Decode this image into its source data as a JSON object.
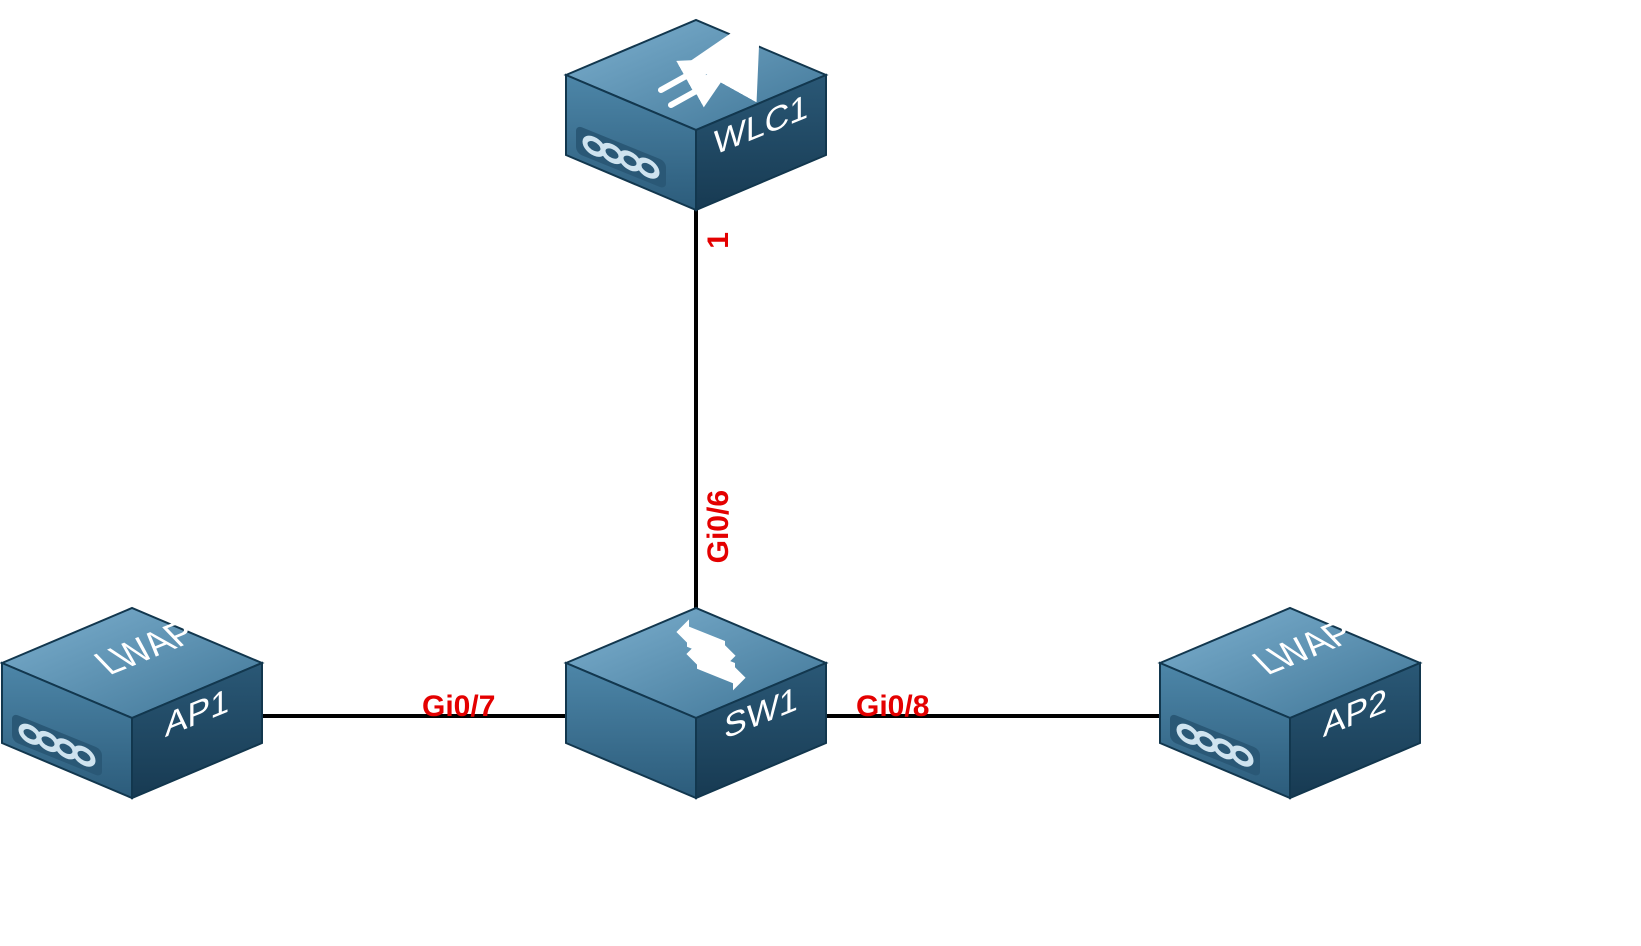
{
  "devices": {
    "wlc1": {
      "label": "WLC1",
      "topCap": ""
    },
    "sw1": {
      "label": "SW1",
      "topCap": ""
    },
    "ap1": {
      "label": "AP1",
      "topCap": "LWAP"
    },
    "ap2": {
      "label": "AP2",
      "topCap": "LWAP"
    }
  },
  "ports": {
    "wlc_down": "1",
    "sw_up": "Gi0/6",
    "sw_left": "Gi0/7",
    "sw_right": "Gi0/8"
  },
  "colors": {
    "portLabel": "#e40000",
    "boxMain": "#4d86a8",
    "boxDark": "#1e4b67",
    "boxLight": "#7db0cf",
    "line": "#000000"
  }
}
